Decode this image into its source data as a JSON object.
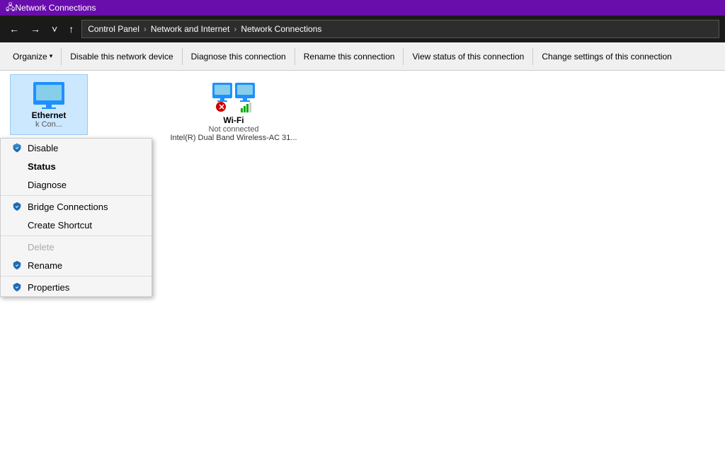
{
  "titleBar": {
    "icon": "network",
    "title": "Network Connections"
  },
  "addressBar": {
    "back": "←",
    "forward": "→",
    "dropdown": "˅",
    "up": "↑",
    "breadcrumb": [
      {
        "label": "Control Panel"
      },
      {
        "label": "Network and Internet"
      },
      {
        "label": "Network Connections"
      }
    ]
  },
  "toolbar": {
    "organize": "Organize",
    "disable": "Disable this network device",
    "diagnose": "Diagnose this connection",
    "rename": "Rename this connection",
    "viewStatus": "View status of this connection",
    "changeSettings": "Change settings of this connection"
  },
  "contextMenu": {
    "items": [
      {
        "id": "disable",
        "label": "Disable",
        "shield": true,
        "bold": false,
        "disabled": false,
        "separator_after": false
      },
      {
        "id": "status",
        "label": "Status",
        "shield": false,
        "bold": true,
        "disabled": false,
        "separator_after": false
      },
      {
        "id": "diagnose",
        "label": "Diagnose",
        "shield": false,
        "bold": false,
        "disabled": false,
        "separator_after": true
      },
      {
        "id": "bridge",
        "label": "Bridge Connections",
        "shield": true,
        "bold": false,
        "disabled": false,
        "separator_after": false
      },
      {
        "id": "shortcut",
        "label": "Create Shortcut",
        "shield": false,
        "bold": false,
        "disabled": false,
        "separator_after": true
      },
      {
        "id": "delete",
        "label": "Delete",
        "shield": false,
        "bold": false,
        "disabled": true,
        "separator_after": false
      },
      {
        "id": "rename",
        "label": "Rename",
        "shield": true,
        "bold": false,
        "disabled": false,
        "separator_after": true
      },
      {
        "id": "properties",
        "label": "Properties",
        "shield": true,
        "bold": false,
        "disabled": false,
        "separator_after": false
      }
    ]
  },
  "networkItems": {
    "ethernet": {
      "name": "Ethernet",
      "label": "k Con...",
      "selected": true
    },
    "wifi": {
      "name": "Wi-Fi",
      "status": "Not connected",
      "detail": "Intel(R) Dual Band Wireless-AC 31..."
    }
  },
  "colors": {
    "titleBarBg": "#6a0dad",
    "selectedBg": "#cce8ff",
    "shieldColor": "#1e6bb8"
  }
}
